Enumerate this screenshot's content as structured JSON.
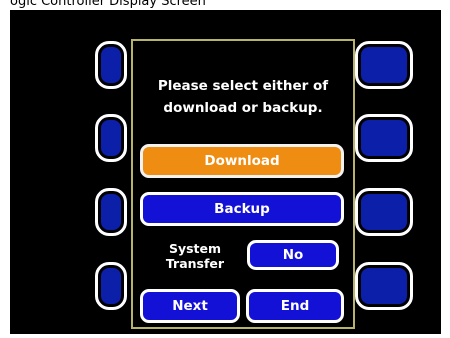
{
  "top_caption": "ogic Controller Display Screen",
  "dialog": {
    "prompt_line1": "Please select either of",
    "prompt_line2": "download or backup.",
    "download_label": "Download",
    "backup_label": "Backup",
    "system_transfer_line1": "System",
    "system_transfer_line2": "Transfer",
    "system_transfer_value": "No",
    "next_label": "Next",
    "end_label": "End"
  },
  "colors": {
    "screen_bg": "#000000",
    "button_blue": "#1411d6",
    "download_orange": "#ef8c12",
    "dialog_border": "#b8b36a",
    "text": "#ffffff"
  }
}
